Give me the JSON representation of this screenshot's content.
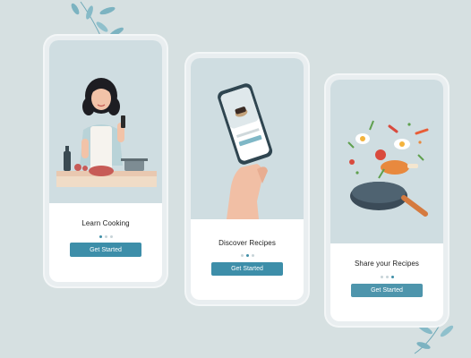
{
  "screens": [
    {
      "title": "Learn Cooking",
      "button": "Get Started",
      "active_dot": 0
    },
    {
      "title": "Discover Recipes",
      "button": "Get Started",
      "active_dot": 1
    },
    {
      "title": "Share your Recipes",
      "button": "Get Started",
      "active_dot": 2
    }
  ],
  "colors": {
    "background": "#d6e0e1",
    "illustration_bg": "#cfdde1",
    "button": "#3d8ea9",
    "active_dot": "#3f8fa8",
    "inactive_dot": "#c7d4d8"
  },
  "icons": [
    "leaf-branch-icon",
    "chef-woman-illustration",
    "phone-in-hand-illustration",
    "flying-food-pan-illustration"
  ]
}
